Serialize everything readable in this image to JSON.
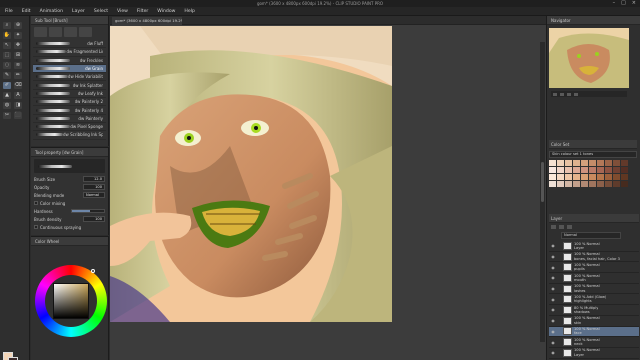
{
  "window": {
    "title": "gom* (3600 x 4800px 600dpi 19.2%) - CLIP STUDIO PAINT PRO",
    "controls": [
      "–",
      "□",
      "×"
    ]
  },
  "menu": [
    "File",
    "Edit",
    "Animation",
    "Layer",
    "Select",
    "View",
    "Filter",
    "Window",
    "Help"
  ],
  "tools": {
    "left_col": [
      "⌕",
      "✋",
      "↖",
      "⬚",
      "◌",
      "✎",
      "✐",
      "▲",
      "◍",
      "✂"
    ],
    "right_col": [
      "⊕",
      "✦",
      "✥",
      "⊞",
      "≋",
      "✏",
      "⌫",
      "A",
      "◨",
      "⬛"
    ]
  },
  "subtool": {
    "header": "Sub Tool [Brush]",
    "brushes": [
      {
        "label": "dw Fluff",
        "selected": false
      },
      {
        "label": "dw Fragmented Line",
        "selected": false
      },
      {
        "label": "dw Freckles",
        "selected": false
      },
      {
        "label": "dw Grain",
        "selected": true
      },
      {
        "label": "dw Hide Variability",
        "selected": false
      },
      {
        "label": "dw Ink Splatter",
        "selected": false
      },
      {
        "label": "dw Leafy Ink",
        "selected": false
      },
      {
        "label": "dw Painterly 2",
        "selected": false
      },
      {
        "label": "dw Painterly 4",
        "selected": false
      },
      {
        "label": "dw Painterly",
        "selected": false
      },
      {
        "label": "dw Pixel Sponge",
        "selected": false
      },
      {
        "label": "dw Scribbling Ink Splatters for Wrap",
        "selected": false
      }
    ]
  },
  "toolprop": {
    "header": "Tool property [dw Grain]",
    "brush_size_label": "Brush Size",
    "brush_size_value": "12.0",
    "opacity_label": "Opacity",
    "opacity_value": "100",
    "blending_label": "Blending mode",
    "blending_value": "Normal",
    "color_mixing_label": "Color mixing",
    "hardness_label": "Hardness",
    "hardness_level": 0.55,
    "density_label": "Brush density",
    "density_value": "100",
    "continuous_label": "Continuous spraying"
  },
  "colorpanel": {
    "header": "Color Wheel"
  },
  "canvas": {
    "tab_label": "gom* (3600 x 4800px 600dpi 19.2%)"
  },
  "navigator": {
    "header": "Navigator"
  },
  "colorset": {
    "header": "Color Set",
    "selector": "Skin colour set 1 tones",
    "swatches": [
      "#f6e2d2",
      "#f0d2b9",
      "#e8c2a3",
      "#dfb28f",
      "#d4a07c",
      "#c48c69",
      "#b37858",
      "#9c6448",
      "#7f4f39",
      "#62392a",
      "#f9e8e0",
      "#f2d6c8",
      "#e9c1ad",
      "#dda995",
      "#ce927e",
      "#bb7b68",
      "#a66653",
      "#8d5241",
      "#704032",
      "#532e24",
      "#fde9d9",
      "#f7d9c2",
      "#efc6a6",
      "#e5b38c",
      "#d89f74",
      "#c98a5e",
      "#b5754b",
      "#9d603b",
      "#804c2e",
      "#613722",
      "#efe0d6",
      "#e2cbbd",
      "#d3b6a4",
      "#c3a08b",
      "#b28a74",
      "#a0755e",
      "#8c604a",
      "#764d39",
      "#5e3b2b",
      "#462b1e"
    ]
  },
  "layers": {
    "header": "Layer",
    "blend_mode": "Normal",
    "rows": [
      {
        "pct": "100 % Normal",
        "name": "Layer",
        "active": false
      },
      {
        "pct": "100 % Normal",
        "name": "bones, facial hair, Color 3",
        "active": false
      },
      {
        "pct": "100 % Normal",
        "name": "pupils",
        "active": false
      },
      {
        "pct": "100 % Normal",
        "name": "mouth",
        "active": false
      },
      {
        "pct": "100 % Normal",
        "name": "lashes",
        "active": false
      },
      {
        "pct": "100 % Add (Glow)",
        "name": "highlights",
        "active": false
      },
      {
        "pct": "80 % Multiply",
        "name": "shadows",
        "active": false
      },
      {
        "pct": "100 % Normal",
        "name": "skin",
        "active": false
      },
      {
        "pct": "100 % Normal",
        "name": "face",
        "active": true
      },
      {
        "pct": "100 % Normal",
        "name": "neck",
        "active": false
      },
      {
        "pct": "100 % Normal",
        "name": "Layer",
        "active": false
      }
    ]
  }
}
